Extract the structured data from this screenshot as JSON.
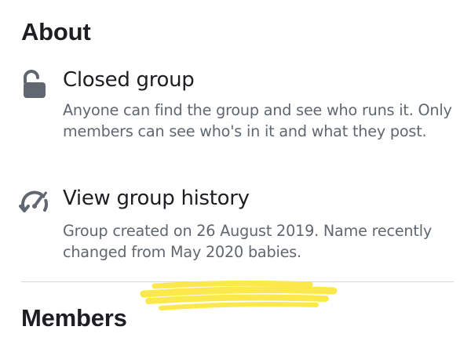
{
  "about": {
    "title": "About"
  },
  "privacy": {
    "icon": "unlocked-padlock-icon",
    "title": "Closed group",
    "description": "Anyone can find the group and see who runs it. Only members can see who's in it and what they post."
  },
  "history": {
    "icon": "history-gauge-icon",
    "title": "View group history",
    "description": "Group created on 26 August 2019. Name recently changed from May 2020 babies."
  },
  "members": {
    "title": "Members"
  },
  "colors": {
    "primary_text": "#1c1e21",
    "secondary_text": "#606770",
    "icon": "#606770",
    "divider": "#d3d6db",
    "highlighter": "#fbe84a"
  }
}
